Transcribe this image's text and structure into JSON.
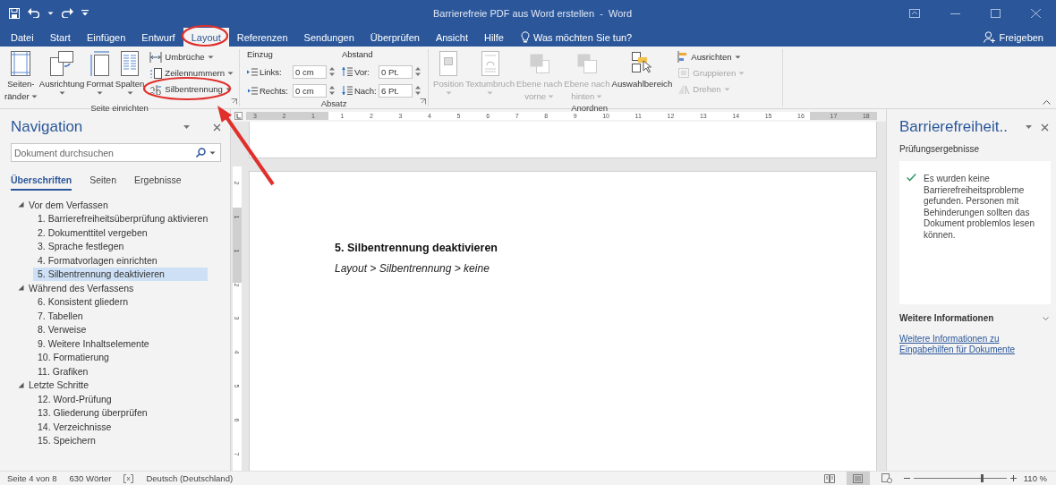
{
  "title_bar": {
    "title": "Barrierefreie PDF aus Word erstellen  -  Word"
  },
  "tabs": [
    {
      "label": "Datei",
      "selected": false
    },
    {
      "label": "Start",
      "selected": false
    },
    {
      "label": "Einfügen",
      "selected": false
    },
    {
      "label": "Entwurf",
      "selected": false
    },
    {
      "label": "Layout",
      "selected": true
    },
    {
      "label": "Referenzen",
      "selected": false
    },
    {
      "label": "Sendungen",
      "selected": false
    },
    {
      "label": "Überprüfen",
      "selected": false
    },
    {
      "label": "Ansicht",
      "selected": false
    },
    {
      "label": "Hilfe",
      "selected": false
    }
  ],
  "tell_me": {
    "label": "Was möchten Sie tun?"
  },
  "share": {
    "label": "Freigeben"
  },
  "ribbon": {
    "groups": [
      {
        "kind": "page_setup",
        "title": "Seite einrichten",
        "large_buttons": [
          {
            "lines": [
              "Seiten-",
              "ränder"
            ],
            "dropdown": true,
            "disabled": false
          },
          {
            "lines": [
              "Ausrichtung"
            ],
            "dropdown": true,
            "disabled": false
          },
          {
            "lines": [
              "Format"
            ],
            "dropdown": true,
            "disabled": false
          },
          {
            "lines": [
              "Spalten"
            ],
            "dropdown": true,
            "disabled": false
          }
        ],
        "small_buttons": [
          {
            "label": "Umbrüche",
            "dropdown": true,
            "disabled": false
          },
          {
            "label": "Zeilennummern",
            "dropdown": true,
            "disabled": false
          },
          {
            "label": "Silbentrennung",
            "dropdown": true,
            "disabled": false
          }
        ]
      },
      {
        "kind": "paragraph",
        "title": "Absatz",
        "indent": {
          "heading": "Einzug",
          "fields": [
            {
              "label": "Links:",
              "value": "0 cm"
            },
            {
              "label": "Rechts:",
              "value": "0 cm"
            }
          ]
        },
        "spacing": {
          "heading": "Abstand",
          "fields": [
            {
              "label": "Vor:",
              "value": "0 Pt."
            },
            {
              "label": "Nach:",
              "value": "6 Pt."
            }
          ]
        }
      },
      {
        "kind": "arrange",
        "title": "Anordnen",
        "large_buttons": [
          {
            "lines": [
              "Position"
            ],
            "dropdown": true,
            "disabled": true
          },
          {
            "lines": [
              "Textumbruch"
            ],
            "dropdown": true,
            "disabled": true
          },
          {
            "lines": [
              "Ebene nach",
              "vorne"
            ],
            "dropdown": true,
            "disabled": true
          },
          {
            "lines": [
              "Ebene nach",
              "hinten"
            ],
            "dropdown": true,
            "disabled": true
          },
          {
            "lines": [
              "Auswahlbereich"
            ],
            "dropdown": false,
            "disabled": false
          }
        ],
        "small_buttons": [
          {
            "label": "Ausrichten",
            "dropdown": true,
            "disabled": false
          },
          {
            "label": "Gruppieren",
            "dropdown": true,
            "disabled": true
          },
          {
            "label": "Drehen",
            "dropdown": true,
            "disabled": true
          }
        ]
      }
    ]
  },
  "navigation": {
    "title": "Navigation",
    "search": {
      "placeholder": "Dokument durchsuchen"
    },
    "tabs": [
      {
        "label": "Überschriften",
        "selected": true
      },
      {
        "label": "Seiten",
        "selected": false
      },
      {
        "label": "Ergebnisse",
        "selected": false
      }
    ],
    "headings": [
      {
        "label": "Vor dem Verfassen",
        "expanded": true,
        "selected": false,
        "children": [
          {
            "label": "1. Barrierefreiheitsüberprüfung aktivieren",
            "selected": false
          },
          {
            "label": "2. Dokumenttitel vergeben",
            "selected": false
          },
          {
            "label": "3. Sprache festlegen",
            "selected": false
          },
          {
            "label": "4. Formatvorlagen einrichten",
            "selected": false
          },
          {
            "label": "5. Silbentrennung deaktivieren",
            "selected": true
          }
        ]
      },
      {
        "label": "Während des Verfassens",
        "expanded": true,
        "selected": false,
        "children": [
          {
            "label": "6. Konsistent gliedern",
            "selected": false
          },
          {
            "label": "7. Tabellen",
            "selected": false
          },
          {
            "label": "8. Verweise",
            "selected": false
          },
          {
            "label": "9. Weitere Inhaltselemente",
            "selected": false
          },
          {
            "label": "10. Formatierung",
            "selected": false
          },
          {
            "label": "11. Grafiken",
            "selected": false
          }
        ]
      },
      {
        "label": "Letzte Schritte",
        "expanded": true,
        "selected": false,
        "children": [
          {
            "label": "12. Word-Prüfung",
            "selected": false
          },
          {
            "label": "13. Gliederung überprüfen",
            "selected": false
          },
          {
            "label": "14. Verzeichnisse",
            "selected": false
          },
          {
            "label": "15. Speichern",
            "selected": false
          }
        ]
      }
    ]
  },
  "document": {
    "horizontal_ruler": [
      "3",
      "2",
      "1",
      "1",
      "2",
      "3",
      "4",
      "5",
      "6",
      "7",
      "8",
      "9",
      "10",
      "11",
      "12",
      "13",
      "14",
      "15",
      "16",
      "17",
      "18"
    ],
    "vertical_ruler": [
      "2",
      "1",
      "1",
      "2",
      "3",
      "4",
      "5",
      "6",
      "7"
    ],
    "heading": "5. Silbentrennung deaktivieren",
    "text": "Layout > Silbentrennung > keine"
  },
  "accessibility_pane": {
    "title": "Barrierefreiheit..",
    "section": "Prüfungsergebnisse",
    "result": "Es wurden keine Barrierefreiheitsprobleme gefunden. Personen mit Behinderungen sollten das Dokument problemlos lesen können.",
    "more_title": "Weitere Informationen",
    "link": "Weitere Informationen zu Eingabehilfen für Dokumente"
  },
  "status_bar": {
    "page": "Seite 4 von 8",
    "words": "630 Wörter",
    "language": "Deutsch (Deutschland)",
    "views": [
      {
        "selected": false
      },
      {
        "selected": true
      },
      {
        "selected": false
      }
    ],
    "zoom": {
      "level": 0.74,
      "reading": "110 %"
    }
  }
}
